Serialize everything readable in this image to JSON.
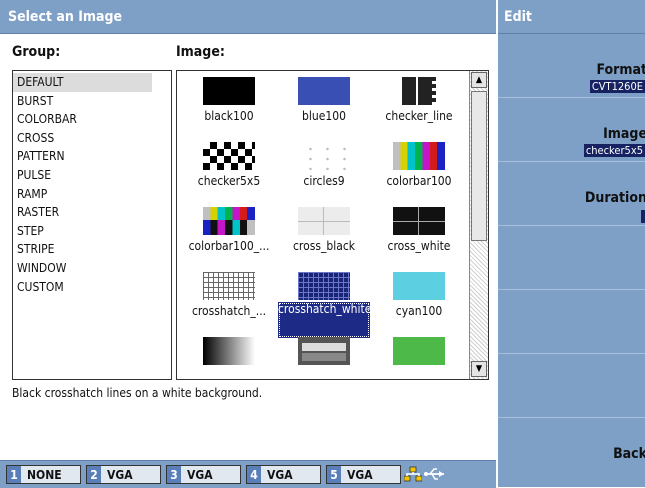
{
  "dialog": {
    "title": "Select an Image",
    "group_heading": "Group:",
    "image_heading": "Image:",
    "description": "Black crosshatch lines on a white background."
  },
  "groups": [
    "DEFAULT",
    "BURST",
    "COLORBAR",
    "CROSS",
    "PATTERN",
    "PULSE",
    "RAMP",
    "RASTER",
    "STEP",
    "STRIPE",
    "WINDOW",
    "CUSTOM"
  ],
  "selected_group": "DEFAULT",
  "images": [
    {
      "name": "black100",
      "icon": "solid-black"
    },
    {
      "name": "blue100",
      "icon": "solid-blue"
    },
    {
      "name": "checker_line",
      "icon": "checker-line"
    },
    {
      "name": "checker5x5",
      "icon": "checker"
    },
    {
      "name": "circles9",
      "icon": "dots"
    },
    {
      "name": "colorbar100",
      "icon": "colorbars"
    },
    {
      "name": "colorbar100_...",
      "icon": "colorbars-split"
    },
    {
      "name": "cross_black",
      "icon": "cross-light"
    },
    {
      "name": "cross_white",
      "icon": "cross-dark"
    },
    {
      "name": "crosshatch_...",
      "icon": "crosshatch-light"
    },
    {
      "name": "crosshatch_white",
      "icon": "crosshatch-dark"
    },
    {
      "name": "cyan100",
      "icon": "solid-cyan"
    },
    {
      "name": "",
      "icon": "gradient"
    },
    {
      "name": "",
      "icon": "mixed"
    },
    {
      "name": "",
      "icon": "solid-green"
    }
  ],
  "selected_image": "crosshatch_white",
  "status_slots": [
    {
      "num": "1",
      "label": "NONE"
    },
    {
      "num": "2",
      "label": "VGA"
    },
    {
      "num": "3",
      "label": "VGA"
    },
    {
      "num": "4",
      "label": "VGA"
    },
    {
      "num": "5",
      "label": "VGA"
    }
  ],
  "edit_panel": {
    "title": "Edit",
    "format_label": "Format",
    "format_value": "CVT1260E",
    "image_label": "Image",
    "image_value": "checker5x5",
    "duration_label": "Duration",
    "back_label": "Back"
  },
  "colors": {
    "header_blue": "#7e9fc6",
    "selection_navy": "#1e2b86"
  }
}
